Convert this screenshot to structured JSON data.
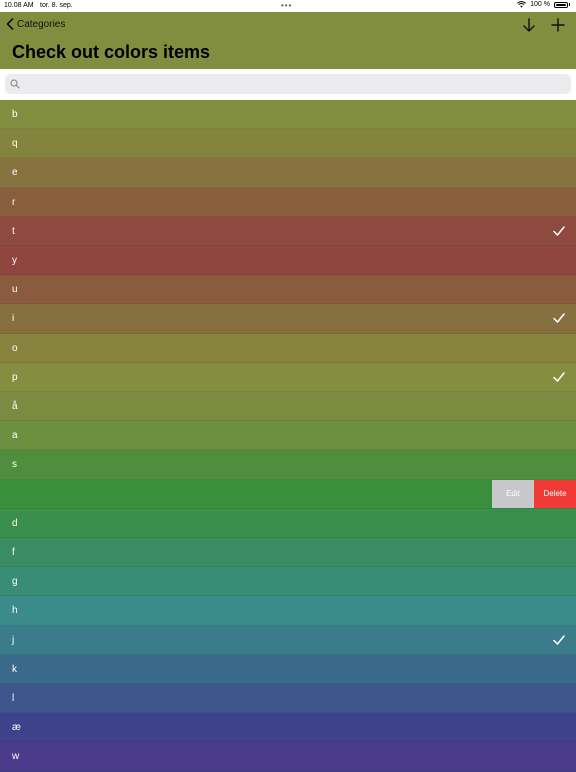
{
  "status_bar": {
    "time": "10.08 AM",
    "date": "tor. 8. sep.",
    "battery": "100 %"
  },
  "nav": {
    "back_label": "Categories",
    "title": "Check out colors items",
    "tint_color": "#818e40"
  },
  "search": {
    "placeholder": "",
    "value": ""
  },
  "items": [
    {
      "label": "b",
      "color": "#818e40",
      "checked": false
    },
    {
      "label": "q",
      "color": "#84843e",
      "checked": false
    },
    {
      "label": "e",
      "color": "#87733f",
      "checked": false
    },
    {
      "label": "r",
      "color": "#8a5f3e",
      "checked": false
    },
    {
      "label": "t",
      "color": "#8e4a3f",
      "checked": true
    },
    {
      "label": "y",
      "color": "#8d453d",
      "checked": false
    },
    {
      "label": "u",
      "color": "#8a5b3e",
      "checked": false
    },
    {
      "label": "i",
      "color": "#877040",
      "checked": true
    },
    {
      "label": "o",
      "color": "#88833f",
      "checked": false
    },
    {
      "label": "p",
      "color": "#848d40",
      "checked": true
    },
    {
      "label": "å",
      "color": "#7b8c40",
      "checked": false
    },
    {
      "label": "a",
      "color": "#6c8f40",
      "checked": false
    },
    {
      "label": "s",
      "color": "#4f8e3d",
      "checked": false
    },
    {
      "label": "",
      "color": "#3b8f3c",
      "checked": false,
      "swiped": true,
      "actions": [
        "Edit",
        "Delete"
      ]
    },
    {
      "label": "d",
      "color": "#3a8f4c",
      "checked": false
    },
    {
      "label": "f",
      "color": "#3a8d62",
      "checked": false
    },
    {
      "label": "g",
      "color": "#398c76",
      "checked": false
    },
    {
      "label": "h",
      "color": "#3a8b89",
      "checked": false
    },
    {
      "label": "j",
      "color": "#3b7c8a",
      "checked": true
    },
    {
      "label": "k",
      "color": "#3b698a",
      "checked": false
    },
    {
      "label": "l",
      "color": "#3c558b",
      "checked": false
    },
    {
      "label": "æ",
      "color": "#3e418b",
      "checked": false
    },
    {
      "label": "w",
      "color": "#4a3c8b",
      "checked": false
    }
  ],
  "colors": {
    "delete_action": "#f13a35",
    "edit_action": "#c7c7cc"
  }
}
